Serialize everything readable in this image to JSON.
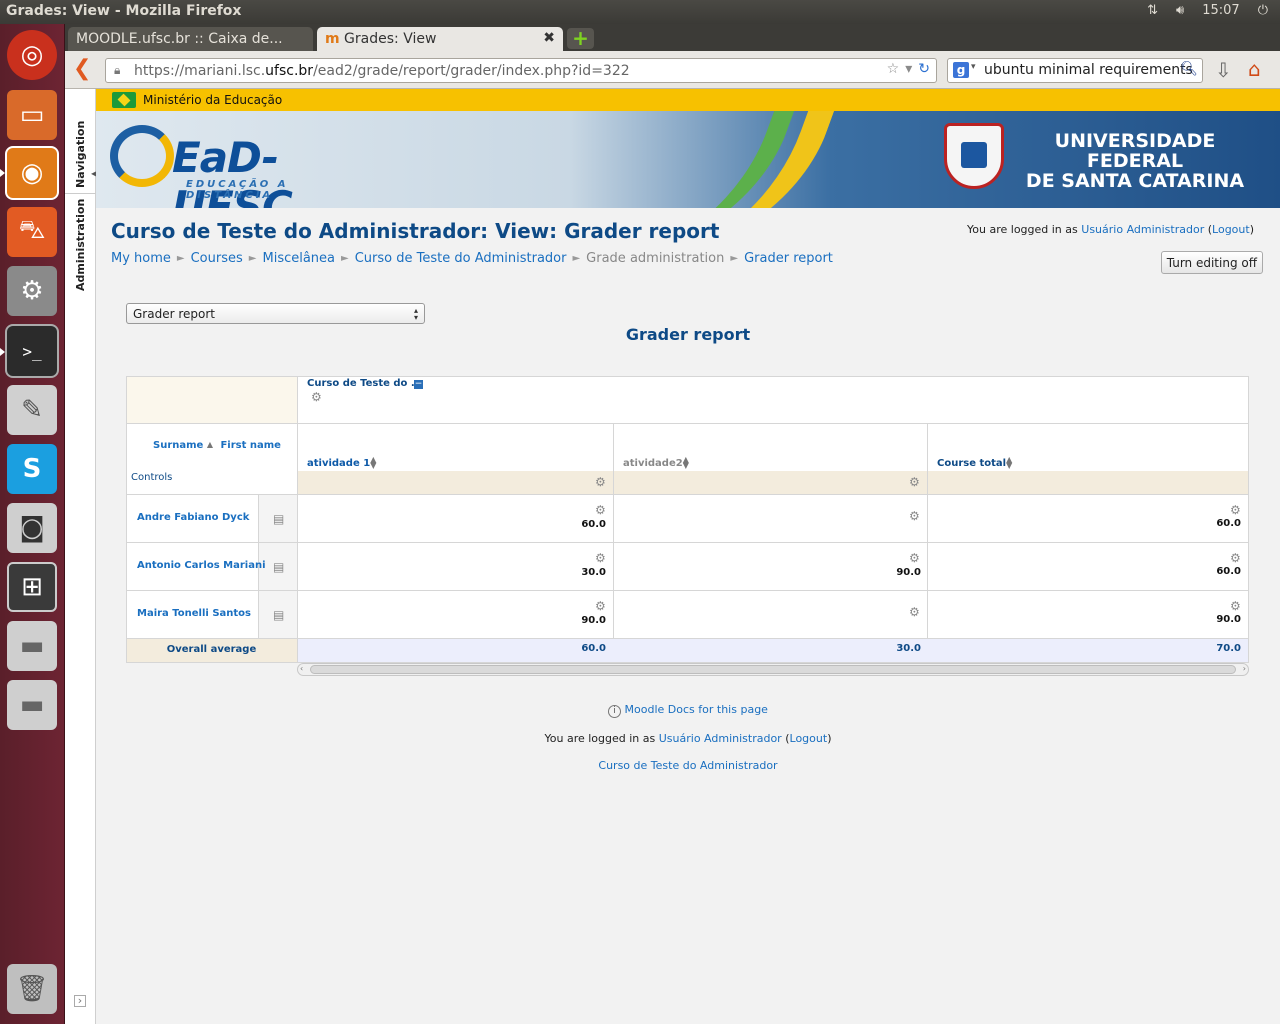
{
  "window": {
    "title": "Grades: View - Mozilla Firefox",
    "clock": "15:07"
  },
  "tabs": [
    {
      "label": "MOODLE.ufsc.br :: Caixa de..."
    },
    {
      "label": "Grades: View"
    }
  ],
  "nav": {
    "url_prefix": "https://mariani.lsc.",
    "url_domain": "ufsc.br",
    "url_suffix": "/ead2/grade/report/grader/index.php?id=322",
    "search_value": "ubuntu minimal requirements"
  },
  "side_tabs": {
    "navigation": "Navigation",
    "administration": "Administration"
  },
  "gov": {
    "label": "Ministério da Educação"
  },
  "banner": {
    "logo_name": "EaD-UFSC",
    "logo_sub": "EDUCAÇÃO A DISTÂNCIA",
    "university_line1": "UNIVERSIDADE FEDERAL",
    "university_line2": "DE SANTA CATARINA"
  },
  "page": {
    "title": "Curso de Teste do Administrador: View: Grader report",
    "login_prefix": "You are logged in as",
    "login_user": "Usuário Administrador",
    "login_open": "(",
    "logout": "Logout",
    "login_close": ")",
    "turn_editing": "Turn editing off"
  },
  "breadcrumb": [
    "My home",
    "Courses",
    "Miscelânea",
    "Curso de Teste do Administrador",
    "Grade administration",
    "Grader report"
  ],
  "report_select": {
    "value": "Grader report"
  },
  "grader": {
    "heading": "Grader report",
    "category": "Curso de Teste do ...",
    "surname": "Surname",
    "first_name": "First name",
    "controls": "Controls",
    "columns": [
      "atividade 1",
      "atividade2",
      "Course total"
    ],
    "rows": [
      {
        "name": "Andre Fabiano Dyck",
        "grades": [
          "60.0",
          "",
          "60.0"
        ]
      },
      {
        "name": "Antonio Carlos Mariani",
        "grades": [
          "30.0",
          "90.0",
          "60.0"
        ]
      },
      {
        "name": "Maira Tonelli Santos",
        "grades": [
          "90.0",
          "",
          "90.0"
        ]
      }
    ],
    "average_label": "Overall average",
    "averages": [
      "60.0",
      "30.0",
      "70.0"
    ]
  },
  "footer": {
    "docs": "Moodle Docs for this page",
    "login_prefix": "You are logged in as",
    "login_user": "Usuário Administrador",
    "logout": "Logout",
    "course": "Curso de Teste do Administrador"
  },
  "colors": {
    "accent": "#1a6fc0",
    "title": "#0e4a86",
    "gov_bar": "#f7c100",
    "launcher": "#6d2433"
  }
}
